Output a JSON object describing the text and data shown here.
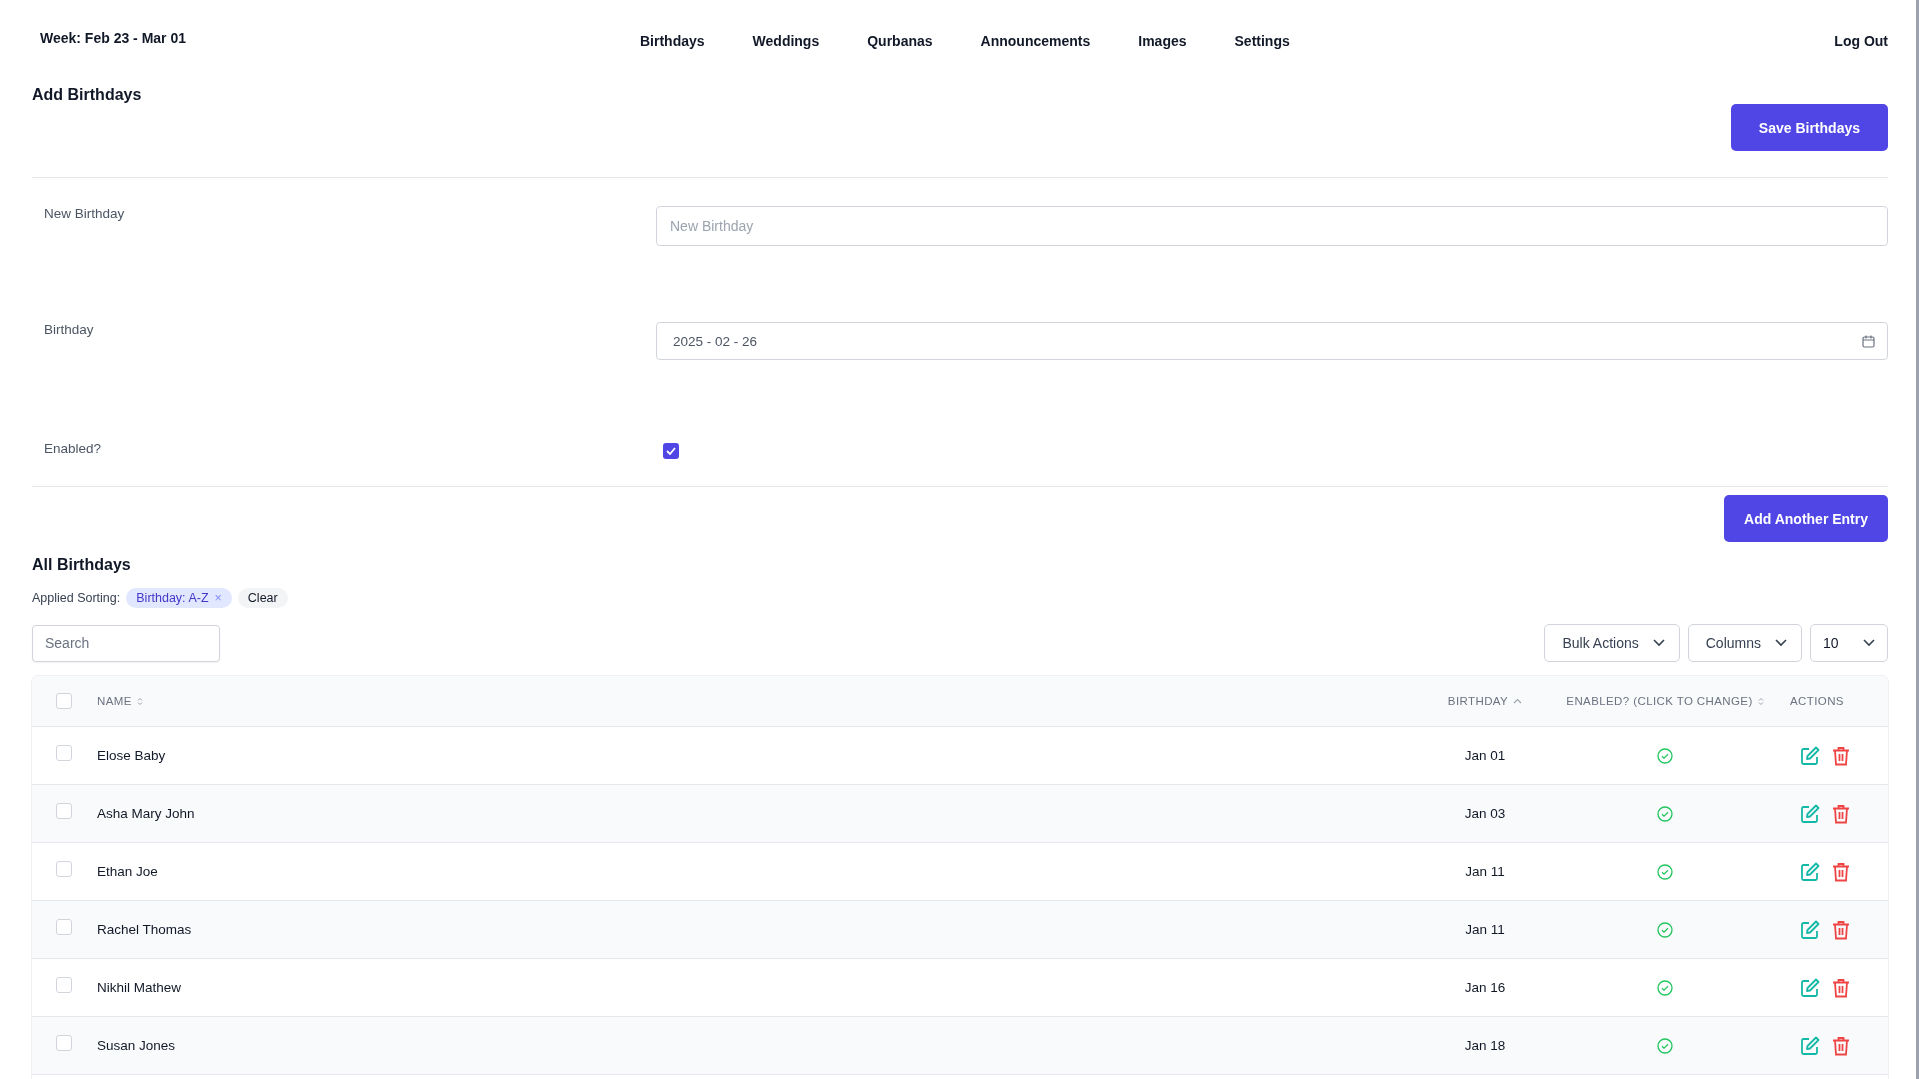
{
  "header": {
    "week": "Week: Feb 23 - Mar 01",
    "nav": [
      {
        "label": "Birthdays"
      },
      {
        "label": "Weddings"
      },
      {
        "label": "Qurbanas"
      },
      {
        "label": "Announcements"
      },
      {
        "label": "Images"
      },
      {
        "label": "Settings"
      }
    ],
    "logout": "Log Out"
  },
  "form": {
    "title": "Add Birthdays",
    "save_button": "Save Birthdays",
    "fields": [
      {
        "kind": "text",
        "label": "New Birthday",
        "placeholder": "New Birthday"
      },
      {
        "kind": "date",
        "label": "Birthday",
        "value": "2025 - 02 - 26"
      },
      {
        "kind": "checkbox",
        "label": "Enabled?",
        "checked": true
      }
    ],
    "add_button": "Add Another Entry"
  },
  "list": {
    "title": "All Birthdays",
    "sorting_label": "Applied Sorting:",
    "sort_chip": "Birthday: A-Z",
    "sort_chip_remove": "×",
    "clear": "Clear",
    "search_placeholder": "Search",
    "bulk_actions": "Bulk Actions",
    "columns_button": "Columns",
    "per_page": "10",
    "all_selected": false,
    "columns": [
      {
        "label": "NAME",
        "kind": "sortable"
      },
      {
        "label": "BIRTHDAY",
        "kind": "ascending"
      },
      {
        "label": "ENABLED? (CLICK TO CHANGE)",
        "kind": "sortable"
      },
      {
        "label": "ACTIONS",
        "kind": "plain"
      }
    ],
    "rows": [
      {
        "name": "Elose Baby",
        "birthday": "Jan 01",
        "enabled": true,
        "selected": false
      },
      {
        "name": "Asha Mary John",
        "birthday": "Jan 03",
        "enabled": true,
        "selected": false
      },
      {
        "name": "Ethan Joe",
        "birthday": "Jan 11",
        "enabled": true,
        "selected": false
      },
      {
        "name": "Rachel Thomas",
        "birthday": "Jan 11",
        "enabled": true,
        "selected": false
      },
      {
        "name": "Nikhil Mathew",
        "birthday": "Jan 16",
        "enabled": true,
        "selected": false
      },
      {
        "name": "Susan Jones",
        "birthday": "Jan 18",
        "enabled": true,
        "selected": false
      }
    ]
  }
}
